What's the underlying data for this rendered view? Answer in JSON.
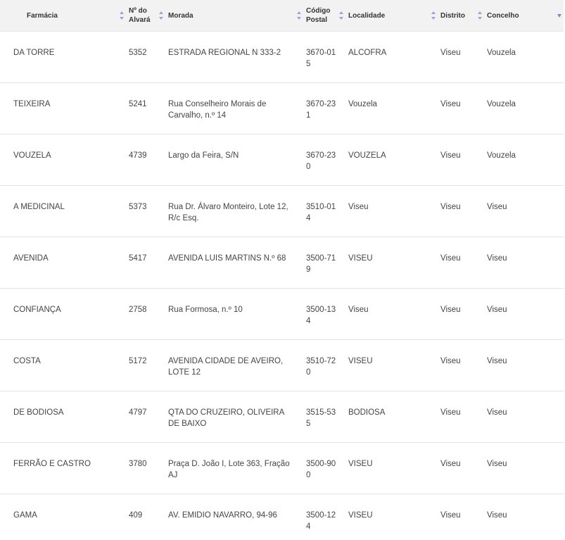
{
  "table": {
    "headers": [
      {
        "id": "farmacia",
        "label": "Farmácia",
        "sort": "both"
      },
      {
        "id": "alvara",
        "label": "Nº do Alvará",
        "sort": "both"
      },
      {
        "id": "morada",
        "label": "Morada",
        "sort": "both"
      },
      {
        "id": "codigo_postal",
        "label": "Código Postal",
        "sort": "both"
      },
      {
        "id": "localidade",
        "label": "Localidade",
        "sort": "both"
      },
      {
        "id": "distrito",
        "label": "Distrito",
        "sort": "both"
      },
      {
        "id": "concelho",
        "label": "Concelho",
        "sort": "descending"
      }
    ],
    "rows": [
      {
        "farmacia": "DA TORRE",
        "alvara": "5352",
        "morada": "ESTRADA REGIONAL N 333-2",
        "codigo_postal": "3670-015",
        "localidade": "ALCOFRA",
        "distrito": "Viseu",
        "concelho": "Vouzela"
      },
      {
        "farmacia": "TEIXEIRA",
        "alvara": "5241",
        "morada": "Rua Conselheiro Morais de Carvalho, n.º 14",
        "codigo_postal": "3670-231",
        "localidade": "Vouzela",
        "distrito": "Viseu",
        "concelho": "Vouzela"
      },
      {
        "farmacia": "VOUZELA",
        "alvara": "4739",
        "morada": "Largo da Feira, S/N",
        "codigo_postal": "3670-230",
        "localidade": "VOUZELA",
        "distrito": "Viseu",
        "concelho": "Vouzela"
      },
      {
        "farmacia": "A MEDICINAL",
        "alvara": "5373",
        "morada": "Rua Dr. Álvaro Monteiro, Lote 12, R/c Esq.",
        "codigo_postal": "3510-014",
        "localidade": "Viseu",
        "distrito": "Viseu",
        "concelho": "Viseu"
      },
      {
        "farmacia": "AVENIDA",
        "alvara": "5417",
        "morada": "AVENIDA LUIS MARTINS N.º 68",
        "codigo_postal": "3500-719",
        "localidade": "VISEU",
        "distrito": "Viseu",
        "concelho": "Viseu"
      },
      {
        "farmacia": "CONFIANÇA",
        "alvara": "2758",
        "morada": "Rua Formosa, n.º 10",
        "codigo_postal": "3500-134",
        "localidade": "Viseu",
        "distrito": "Viseu",
        "concelho": "Viseu"
      },
      {
        "farmacia": "COSTA",
        "alvara": "5172",
        "morada": "AVENIDA CIDADE DE AVEIRO, LOTE 12",
        "codigo_postal": "3510-720",
        "localidade": "VISEU",
        "distrito": "Viseu",
        "concelho": "Viseu"
      },
      {
        "farmacia": "DE BODIOSA",
        "alvara": "4797",
        "morada": "QTA DO CRUZEIRO, OLIVEIRA DE BAIXO",
        "codigo_postal": "3515-535",
        "localidade": "BODIOSA",
        "distrito": "Viseu",
        "concelho": "Viseu"
      },
      {
        "farmacia": "FERRÃO E CASTRO",
        "alvara": "3780",
        "morada": "Praça D. João I, Lote 363, Fração AJ",
        "codigo_postal": "3500-900",
        "localidade": "VISEU",
        "distrito": "Viseu",
        "concelho": "Viseu"
      },
      {
        "farmacia": "GAMA",
        "alvara": "409",
        "morada": "AV. EMIDIO NAVARRO, 94-96",
        "codigo_postal": "3500-124",
        "localidade": "VISEU",
        "distrito": "Viseu",
        "concelho": "Viseu"
      }
    ]
  }
}
